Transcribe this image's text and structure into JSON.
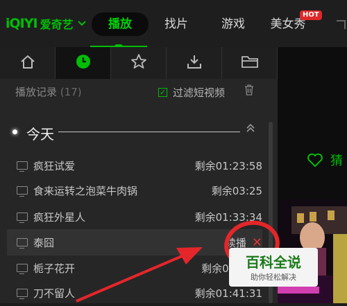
{
  "brand": {
    "logo": "iQIYI",
    "name": "爱奇艺",
    "accent": "#00be06"
  },
  "nav": {
    "items": [
      "播放",
      "找片",
      "游戏",
      "美女秀"
    ],
    "active": "播放",
    "hot_badge": "HOT"
  },
  "tabs": [
    "home-icon",
    "history-icon",
    "star-icon",
    "download-icon",
    "folder-icon"
  ],
  "history": {
    "title": "播放记录",
    "count": "(17)",
    "filter_label": "过滤短视频",
    "filter_checked": true,
    "section": "今天",
    "rows": [
      {
        "title": "疯狂试爱",
        "remain": "剩余01:23:58"
      },
      {
        "title": "食来运转之泡菜牛肉锅",
        "remain": "剩余03:25"
      },
      {
        "title": "疯狂外星人",
        "remain": "剩余01:33:34"
      },
      {
        "title": "泰囧",
        "remain": "续播",
        "close": "✕"
      },
      {
        "title": "栀子花开",
        "remain": "剩余01:40:5"
      },
      {
        "title": "刀不留人",
        "remain": "剩余01:41:31"
      }
    ]
  },
  "right_pane": {
    "text": "猜"
  },
  "watermark": {
    "main": "百科全说",
    "sub": "助你轻松解决"
  }
}
